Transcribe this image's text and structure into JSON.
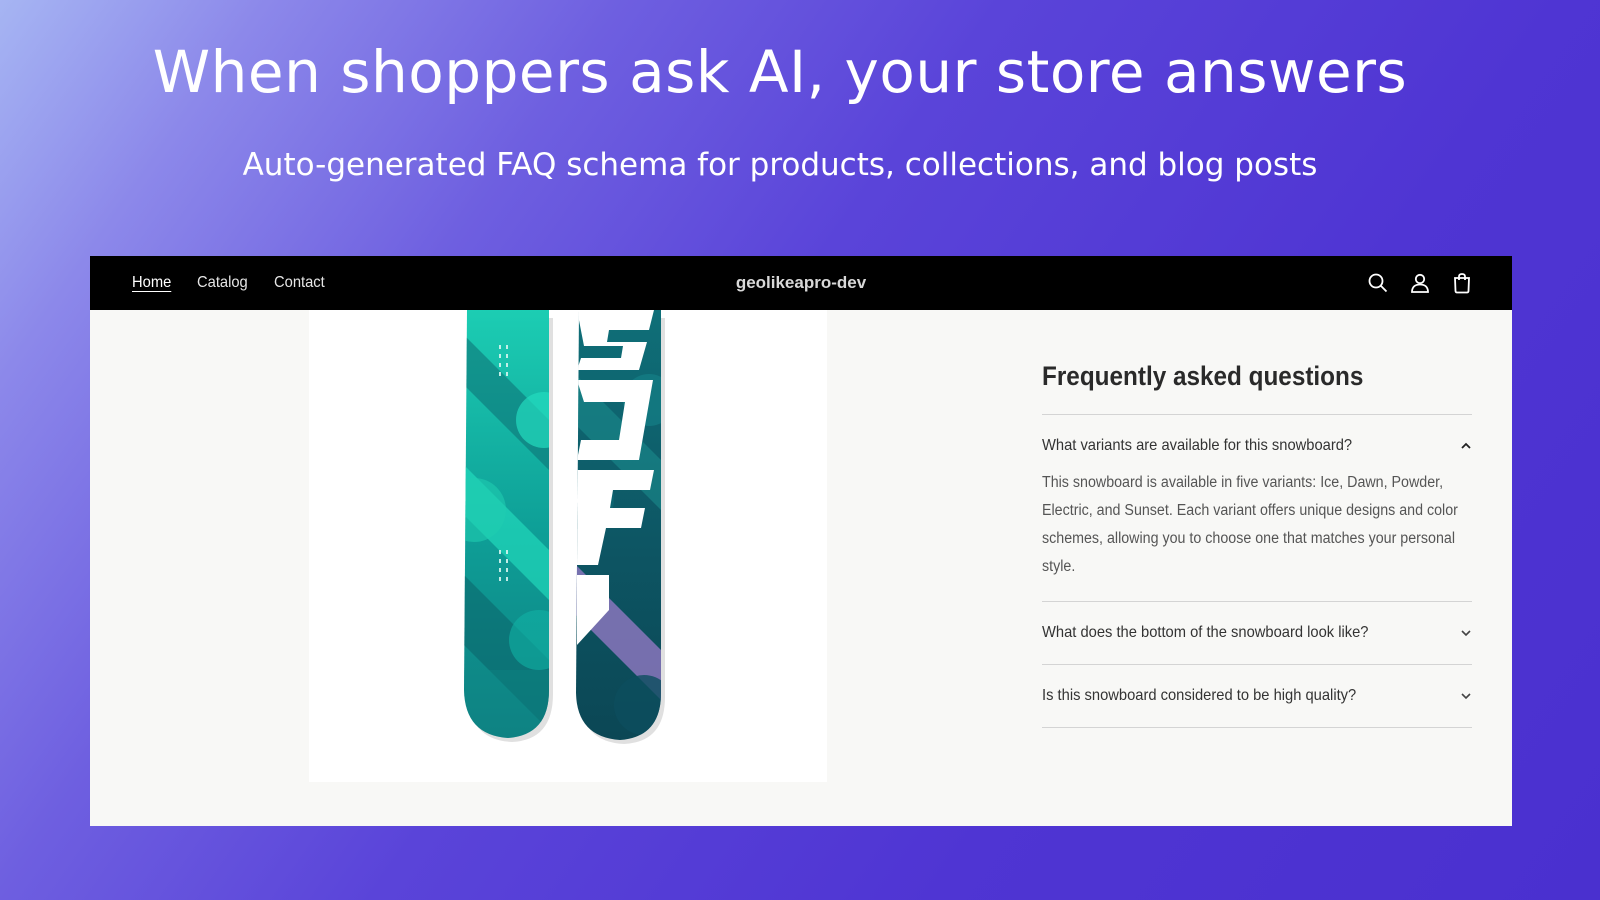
{
  "hero": {
    "headline": "When shoppers ask AI, your store answers",
    "subheadline": "Auto-generated FAQ schema for products, collections, and blog posts"
  },
  "store": {
    "nav": [
      {
        "label": "Home",
        "active": true
      },
      {
        "label": "Catalog",
        "active": false
      },
      {
        "label": "Contact",
        "active": false
      }
    ],
    "name": "geolikeapro-dev",
    "icons": [
      "search-icon",
      "account-icon",
      "cart-icon"
    ]
  },
  "product_image": {
    "board_text": "SHOPIFY",
    "colors": {
      "teal": "#1fd3b4",
      "dark_teal": "#0d5a66",
      "purple": "#9a7bc9"
    }
  },
  "faq": {
    "title": "Frequently asked questions",
    "items": [
      {
        "question": "What variants are available for this snowboard?",
        "answer": "This snowboard is available in five variants: Ice, Dawn, Powder, Electric, and Sunset. Each variant offers unique designs and color schemes, allowing you to choose one that matches your personal style.",
        "expanded": true
      },
      {
        "question": "What does the bottom of the snowboard look like?",
        "answer": "",
        "expanded": false
      },
      {
        "question": "Is this snowboard considered to be high quality?",
        "answer": "",
        "expanded": false
      }
    ]
  }
}
